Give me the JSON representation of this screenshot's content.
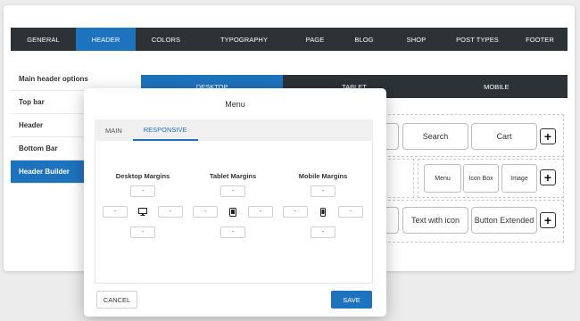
{
  "top_nav": [
    "GENERAL",
    "HEADER",
    "COLORS",
    "TYPOGRAPHY",
    "PAGE",
    "BLOG",
    "SHOP",
    "POST TYPES",
    "FOOTER"
  ],
  "top_nav_active": "HEADER",
  "side_nav": [
    "Main header options",
    "Top bar",
    "Header",
    "Bottom Bar",
    "Header Builder"
  ],
  "side_nav_active": "Header Builder",
  "device_tabs": [
    "DESKTOP",
    "TABLET",
    "MOBILE"
  ],
  "device_tabs_active": "DESKTOP",
  "builder": {
    "row1": [
      "Search",
      "Cart"
    ],
    "row2": [
      "Menu",
      "Icon Box",
      "Image"
    ],
    "row3": [
      "Text with icon",
      "Button Extended"
    ],
    "plus": "+"
  },
  "modal": {
    "title": "Menu",
    "tabs": [
      "MAIN",
      "RESPONSIVE"
    ],
    "active_tab": "RESPONSIVE",
    "groups": [
      {
        "label": "Desktop Margins",
        "icon": "desktop-icon",
        "top": "-",
        "left": "-",
        "right": "-",
        "bottom": "-"
      },
      {
        "label": "Tablet Margins",
        "icon": "tablet-icon",
        "top": "-",
        "left": "-",
        "right": "-",
        "bottom": "-"
      },
      {
        "label": "Mobile Margins",
        "icon": "mobile-icon",
        "top": "-",
        "left": "-",
        "right": "-",
        "bottom": "-"
      }
    ],
    "cancel": "CANCEL",
    "save": "SAVE"
  },
  "colors": {
    "accent": "#1e73be",
    "dark": "#2c3236"
  }
}
